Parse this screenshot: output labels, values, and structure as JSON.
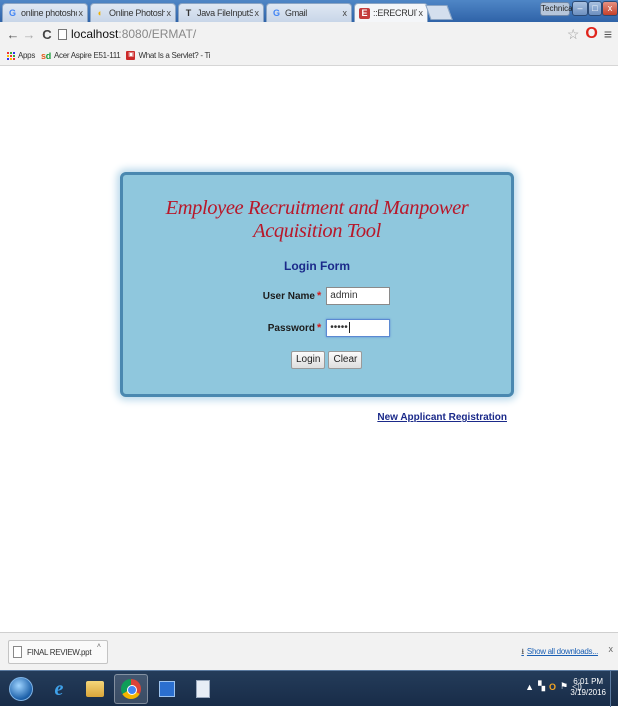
{
  "browser": {
    "tabs": [
      {
        "label": "online photoshop free - (",
        "favicon": "G",
        "favicon_color": "#4285f4",
        "close": "x"
      },
      {
        "label": "Online Photoshop Free -",
        "favicon": "◐",
        "favicon_color": "#f0b000",
        "close": "x"
      },
      {
        "label": "Java FileInputStream and",
        "favicon": "T",
        "favicon_color": "#333333",
        "close": "x"
      },
      {
        "label": "Gmail",
        "favicon": "G",
        "favicon_color": "#4285f4",
        "close": "x"
      },
      {
        "label": "::ERECRUITMENT::",
        "favicon": "E",
        "favicon_color": "#c43c3c",
        "close": "x",
        "active": true
      }
    ],
    "profile_label": "Technical",
    "window_controls": {
      "minimize": "–",
      "maximize": "□",
      "close": "x"
    },
    "toolbar": {
      "back": "←",
      "forward": "→",
      "reload": "C",
      "url_host": "localhost",
      "url_rest": ":8080/ERMAT/",
      "star": "☆",
      "opera": "O",
      "menu": "≡"
    },
    "bookmarks": [
      {
        "label": "Apps",
        "icon": "apps-grid-icon"
      },
      {
        "label": "Acer Aspire E51-111",
        "icon": "acer-icon"
      },
      {
        "label": "What Is a Servlet? - Ti",
        "icon": "servlet-icon"
      }
    ]
  },
  "page": {
    "app_title": "Employee Recruitment and Manpower Acquisition Tool",
    "form_title": "Login Form",
    "username": {
      "label": "User Name",
      "required_mark": "*",
      "value": "admin"
    },
    "password": {
      "label": "Password",
      "required_mark": "*",
      "value": "•••••"
    },
    "buttons": {
      "login": "Login",
      "clear": "Clear"
    },
    "register_link": "New Applicant Registration",
    "colors": {
      "panel_bg": "#8fc7dd",
      "title_red": "#b8182a",
      "link_navy": "#1b2a8a"
    }
  },
  "downloads": {
    "file": "FINAL REVIEW.ppt",
    "caret": "˄",
    "show_all": "Show all downloads...",
    "close": "x"
  },
  "taskbar": {
    "items": [
      "start-orb",
      "internet-explorer-icon",
      "file-explorer-icon",
      "chrome-icon",
      "windows-app-icon",
      "document-app-icon"
    ],
    "tray": {
      "arrow": "▲"
    },
    "time": "6:01 PM",
    "date": "3/19/2016"
  }
}
